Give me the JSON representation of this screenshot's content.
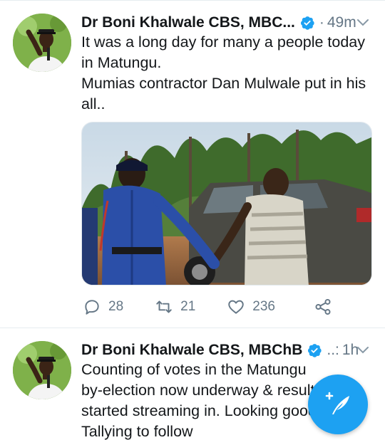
{
  "tweets": [
    {
      "author_name": "Dr Boni Khalwale CBS, MBC...",
      "separator": "·",
      "timestamp": "49m",
      "text_lines": [
        "It was a long day for many a people today",
        "in Matungu.",
        "Mumias contractor Dan Mulwale put in his",
        "all.."
      ],
      "reply_count": "28",
      "retweet_count": "21",
      "like_count": "236"
    },
    {
      "author_name": "Dr Boni Khalwale CBS, MBChB",
      "separator": "..:",
      "timestamp": "1h",
      "text_lines": [
        "Counting of votes in the Matungu",
        "by-election now underway & results",
        "started streaming in. Looking good.",
        "Tallying to follow"
      ]
    }
  ],
  "colors": {
    "accent": "#1da1f2",
    "text_primary": "#14171a",
    "text_secondary": "#657786",
    "divider": "#e6ecf0"
  },
  "icons": {
    "verified": "verified-badge-icon",
    "caret": "chevron-down-icon",
    "reply": "reply-bubble-icon",
    "retweet": "retweet-icon",
    "like": "heart-icon",
    "share": "share-icon",
    "compose": "compose-tweet-icon"
  }
}
